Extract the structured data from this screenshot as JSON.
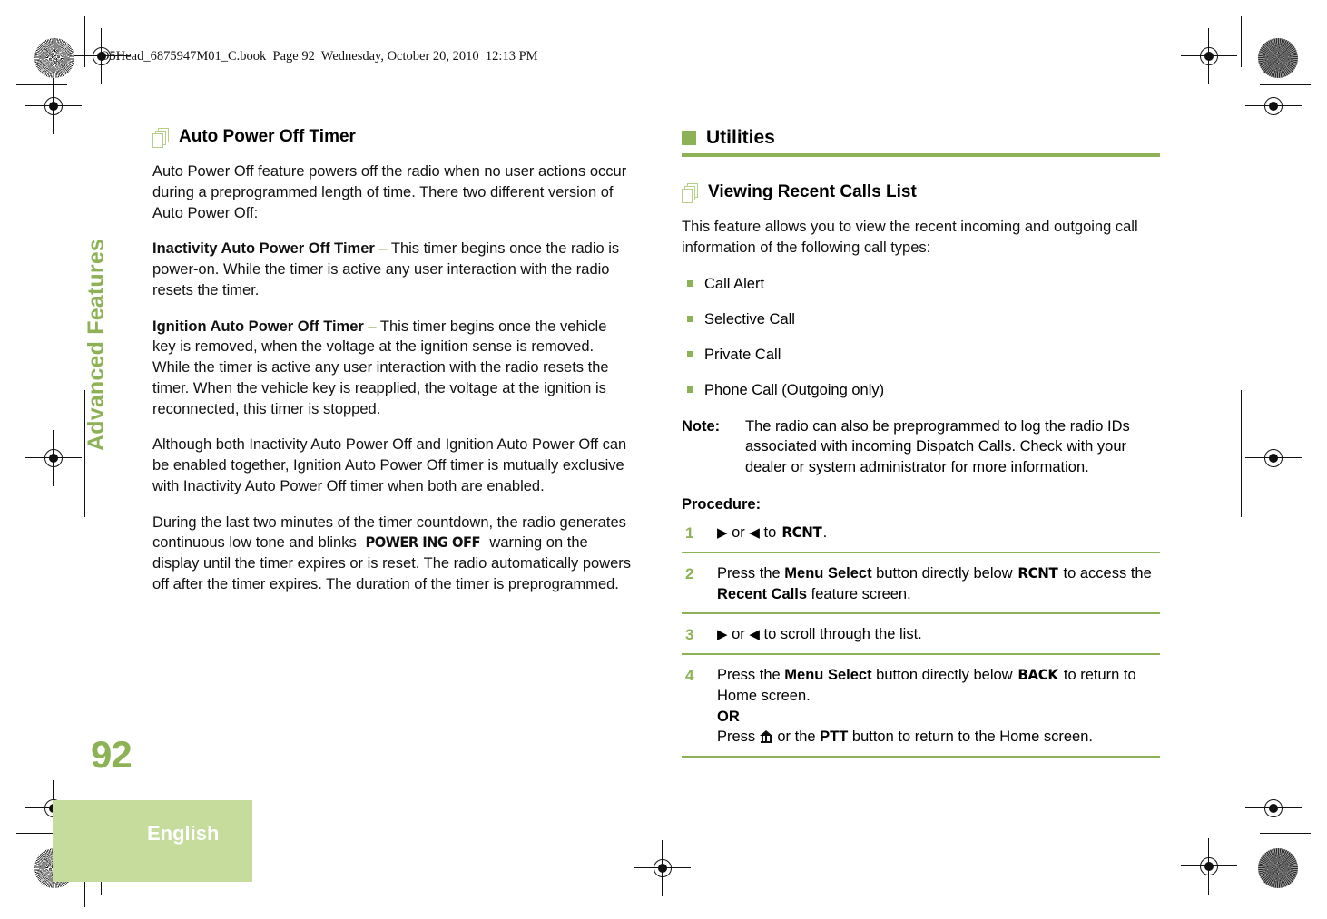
{
  "header": {
    "running_head": "O5Head_6875947M01_C.book  Page 92  Wednesday, October 20, 2010  12:13 PM"
  },
  "sidebar": {
    "chapter_label": "Advanced Features",
    "page_number": "92",
    "language": "English",
    "accent_color": "#8DB255",
    "language_box_color": "#C5DC9C"
  },
  "left_column": {
    "heading": "Auto Power Off Timer",
    "heading_icon": "stacked-pages-icon",
    "paragraphs": {
      "intro": "Auto Power Off feature powers off the radio when no user actions occur during a preprogrammed length of time. There two different version of Auto Power Off:",
      "inactivity_term": "Inactivity Auto Power Off Timer",
      "inactivity_dash": "–",
      "inactivity_text": "This timer begins once the radio is power-on. While the timer is active any user interaction with the radio resets the timer.",
      "ignition_term": "Ignition Auto Power Off Timer",
      "ignition_dash": "–",
      "ignition_text": "This timer begins once the vehicle key is removed, when the voltage at the ignition sense is removed. While the timer is active any user interaction with the radio resets the timer. When the vehicle key is reapplied, the voltage at the ignition is reconnected, this timer is stopped.",
      "mutual": "Although both Inactivity Auto Power Off and Ignition Auto Power Off can be enabled together, Ignition Auto Power Off timer is mutually exclusive with Inactivity Auto Power Off timer when both are enabled.",
      "countdown_pre": "During the last two minutes of the timer countdown, the radio generates continuous low tone and blinks ",
      "countdown_display": "POWER ING OFF",
      "countdown_post": " warning on the display until the timer expires or is reset. The radio automatically powers off after the timer expires. The duration of the timer is preprogrammed."
    }
  },
  "right_column": {
    "section_heading": "Utilities",
    "section_icon": "green-square-bullet",
    "sub_heading": "Viewing Recent Calls List",
    "sub_heading_icon": "stacked-pages-icon",
    "intro": "This feature allows you to view the recent incoming and outgoing call information of the following call types:",
    "call_types": [
      "Call Alert",
      "Selective Call",
      "Private Call",
      "Phone Call (Outgoing only)"
    ],
    "note": {
      "label": "Note:",
      "text": "The radio can also be preprogrammed to log the radio IDs associated with incoming Dispatch Calls. Check with your dealer or system administrator for more information."
    },
    "procedure_label": "Procedure:",
    "steps": [
      {
        "number": "1",
        "arrow_right": "▶",
        "or": " or ",
        "arrow_left": "◀",
        "text_before": " to ",
        "softkey": "RCNT",
        "text_after": "."
      },
      {
        "number": "2",
        "text_a": "Press the ",
        "bold_a": "Menu Select",
        "text_b": " button directly below ",
        "softkey": "RCNT",
        "text_c": " to access the ",
        "bold_b": "Recent Calls",
        "text_d": " feature screen."
      },
      {
        "number": "3",
        "arrow_right": "▶",
        "or": " or ",
        "arrow_left": "◀",
        "text_after": " to scroll through the list."
      },
      {
        "number": "4",
        "text_a": "Press the ",
        "bold_a": "Menu Select",
        "text_b": " button directly below ",
        "softkey": "BACK",
        "text_c": " to return to Home screen.",
        "or_label": "OR",
        "text_d": "Press ",
        "home_icon": "home-icon",
        "text_e": " or the ",
        "bold_b": "PTT",
        "text_f": " button to return to the Home screen."
      }
    ]
  }
}
